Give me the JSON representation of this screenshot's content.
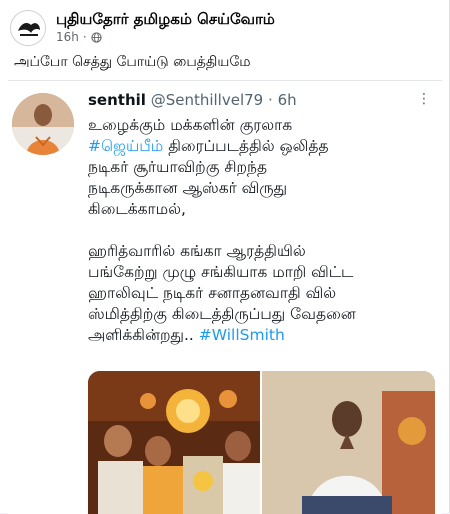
{
  "post": {
    "page_name": "புதியதோர் தமிழகம் செய்வோம்",
    "time": "16h",
    "dot": "·",
    "audience_icon": "globe-icon",
    "text": "அப்போ செத்து போய்டு பைத்தியமே"
  },
  "tweet": {
    "name": "senthil",
    "handle": "@Senthillvel79",
    "dot": "·",
    "time": "6h",
    "more": "⋮",
    "lines": {
      "l1": "உழைக்கும் மக்களின் குரலாக",
      "l2_hashtag": "#ஜெய்பீம்",
      "l2_rest": " திரைப்படத்தில் ஒலித்த",
      "l3": "நடிகர் சூர்யாவிற்கு சிறந்த",
      "l4": "நடிகருக்கான ஆஸ்கர் விருது",
      "l5": "கிடைக்காமல்,",
      "l6": "ஹரித்வாரில் கங்கா ஆரத்தியில்",
      "l7": "பங்கேற்று முழு சங்கியாக மாறி விட்ட",
      "l8": "ஹாலிவுட் நடிகர் சனாதனவாதி வில்",
      "l9": "ஸ்மித்திற்கு கிடைத்திருப்பது வேதனை",
      "l10_text": "அளிக்கின்றது.. ",
      "l10_hashtag": "#WillSmith"
    }
  },
  "colors": {
    "hashtag": "#1d9bf0",
    "text": "#0f1419",
    "muted": "#536471"
  }
}
